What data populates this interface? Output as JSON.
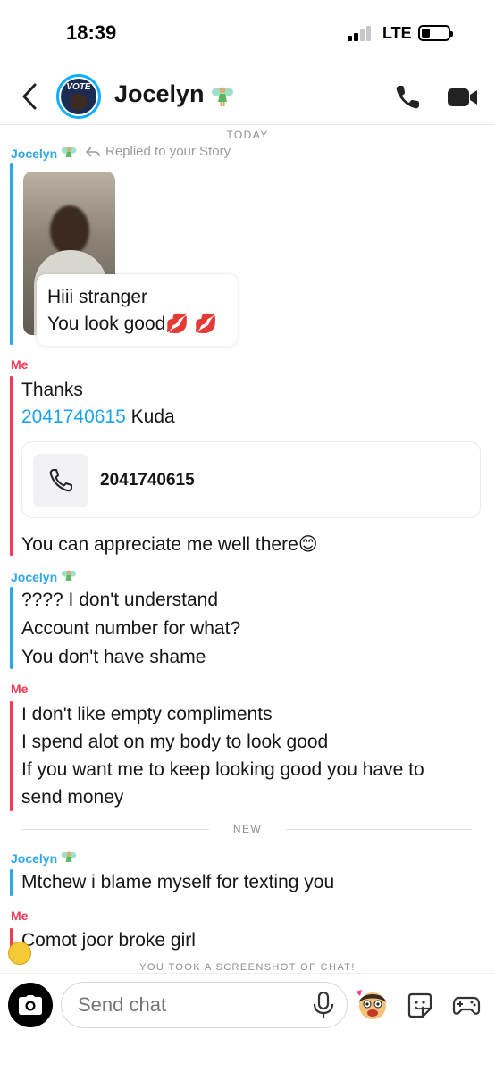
{
  "status_bar": {
    "time": "18:39",
    "network": "LTE"
  },
  "header": {
    "back_icon": "chevron-left-icon",
    "contact_name": "Jocelyn",
    "avatar_text": "VOTE",
    "call_icon": "phone-icon",
    "video_icon": "video-camera-icon"
  },
  "chat": {
    "day_label": "TODAY",
    "new_label": "NEW",
    "screenshot_notice": "YOU TOOK A SCREENSHOT OF CHAT!",
    "messages": [
      {
        "sender": "Jocelyn",
        "reply_note": "Replied to your Story",
        "story_caption": [
          "Hiii stranger",
          "You look good💋 💋"
        ]
      },
      {
        "sender": "Me",
        "lines": [
          "Thanks"
        ],
        "phone_link": "2041740615",
        "after_link": " Kuda",
        "contact_card_number": "2041740615",
        "final_line": "You can appreciate me well there😊"
      },
      {
        "sender": "Jocelyn",
        "lines": [
          "???? I don't understand",
          "Account number for what?",
          "You don't have shame"
        ]
      },
      {
        "sender": "Me",
        "lines": [
          "I don't like empty compliments",
          "I spend alot on my body to look good",
          "If you want me to keep looking good you have to",
          "send money"
        ]
      },
      {
        "sender": "Jocelyn",
        "lines": [
          "Mtchew i blame myself for texting you"
        ]
      },
      {
        "sender": "Me",
        "lines": [
          "Comot joor broke girl"
        ]
      }
    ]
  },
  "composer": {
    "placeholder": "Send chat",
    "camera_icon": "camera-icon",
    "mic_icon": "microphone-icon",
    "bitmoji_icon": "bitmoji-icon",
    "sticker_icon": "sticker-icon",
    "games_icon": "game-controller-icon"
  },
  "colors": {
    "accent_blue": "#2ea8e8",
    "me_red": "#f23c57",
    "link_blue": "#1ba4e6"
  }
}
